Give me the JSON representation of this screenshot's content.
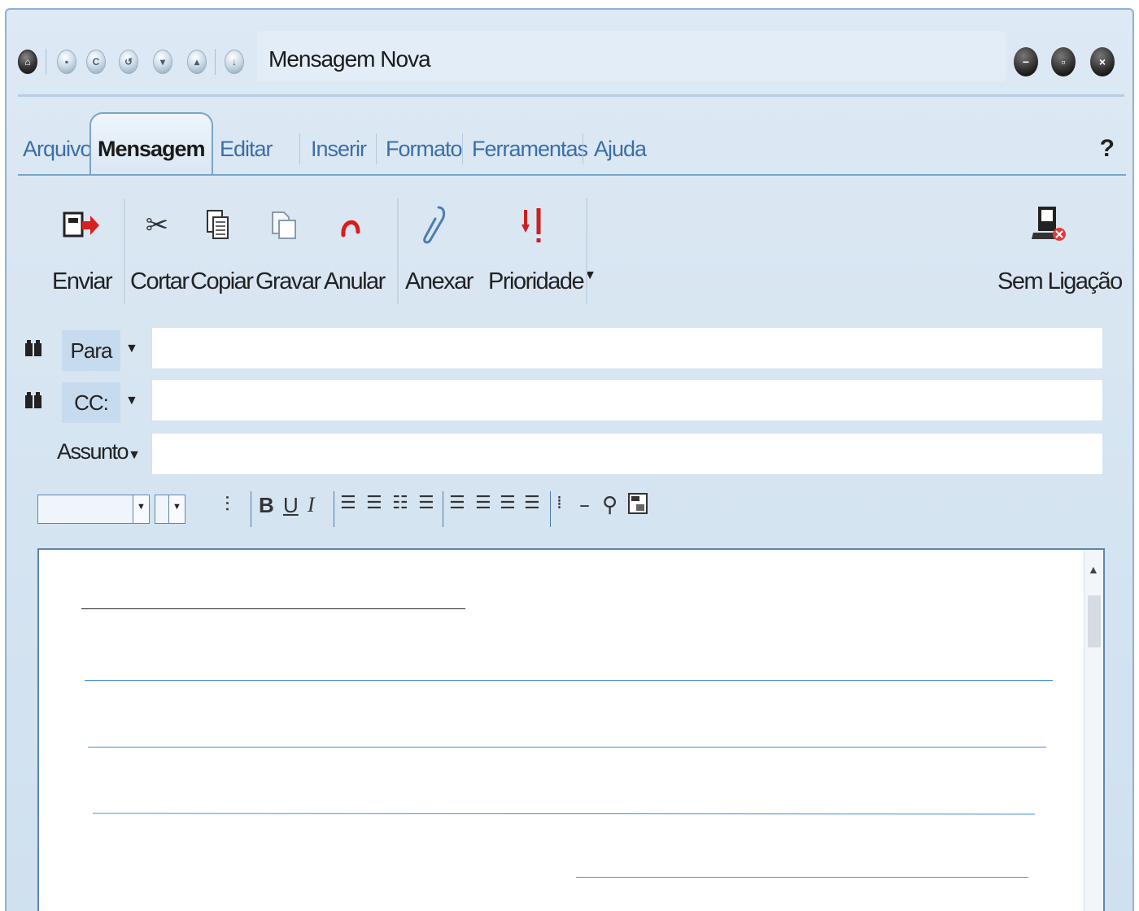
{
  "window": {
    "title": "Mensagem Nova",
    "toolbar_icons": [
      "home-icon",
      "save-icon",
      "refresh-icon",
      "undo-icon",
      "arrow-down-icon",
      "arrow-up-icon",
      "download-icon"
    ],
    "window_controls": [
      "minimize-icon",
      "restore-icon",
      "close-icon"
    ]
  },
  "menu": {
    "tabs": [
      "Arquivo",
      "Mensagem",
      "Editar",
      "Inserir",
      "Formato",
      "Ferramentas",
      "Ajuda"
    ],
    "active_tab": "Mensagem",
    "help": "?"
  },
  "ribbon": {
    "send": "Enviar",
    "cut": "Cortar",
    "copy": "Copiar",
    "save": "Gravar",
    "undo": "Anular",
    "attach": "Anexar",
    "priority": "Prioridade",
    "offline": "Sem Ligação"
  },
  "address": {
    "to_label": "Para",
    "cc_label": "CC:",
    "subject_label": "Assunto",
    "to_value": "",
    "cc_value": "",
    "subject_value": ""
  },
  "format_toolbar": {
    "font_value": "",
    "size_value": "",
    "bold": "B",
    "underline": "U",
    "italic": "I"
  },
  "colors": {
    "accent": "#3b6ea8",
    "border": "#5f86ab",
    "body_line": "#4a90d9",
    "priority_red": "#cc1f1f"
  }
}
